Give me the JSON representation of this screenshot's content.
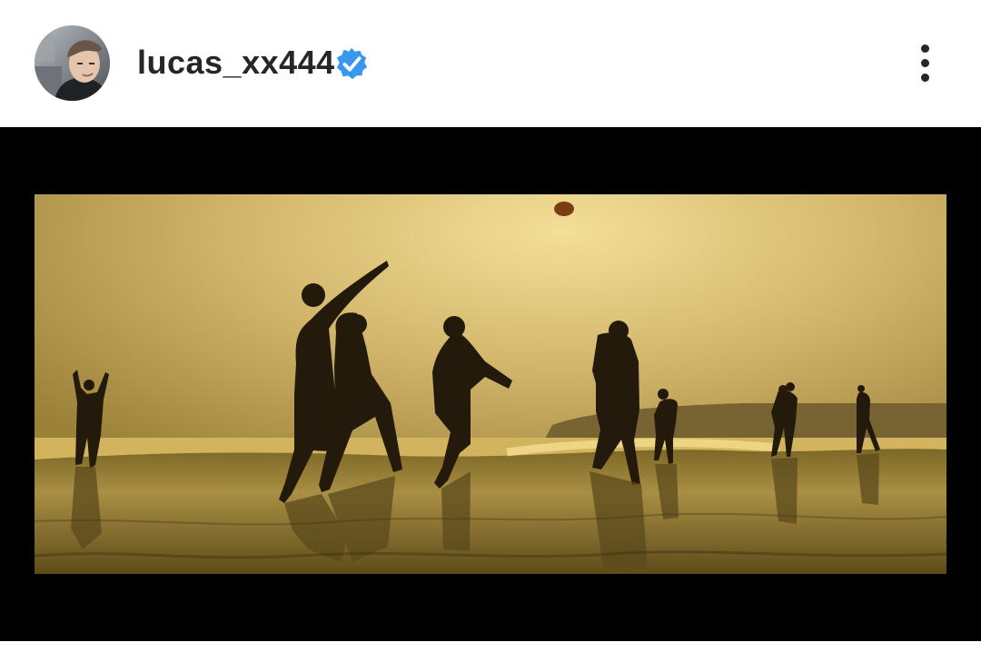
{
  "post": {
    "username": "lucas_xx444",
    "verified": true
  },
  "icons": {
    "verified": "verified-badge-icon",
    "more": "more-options-icon"
  },
  "colors": {
    "text": "#262626",
    "verified_blue": "#3897f0",
    "media_background": "#000000",
    "sky": "#c8ab5d",
    "sun_glow": "#f4df98"
  }
}
